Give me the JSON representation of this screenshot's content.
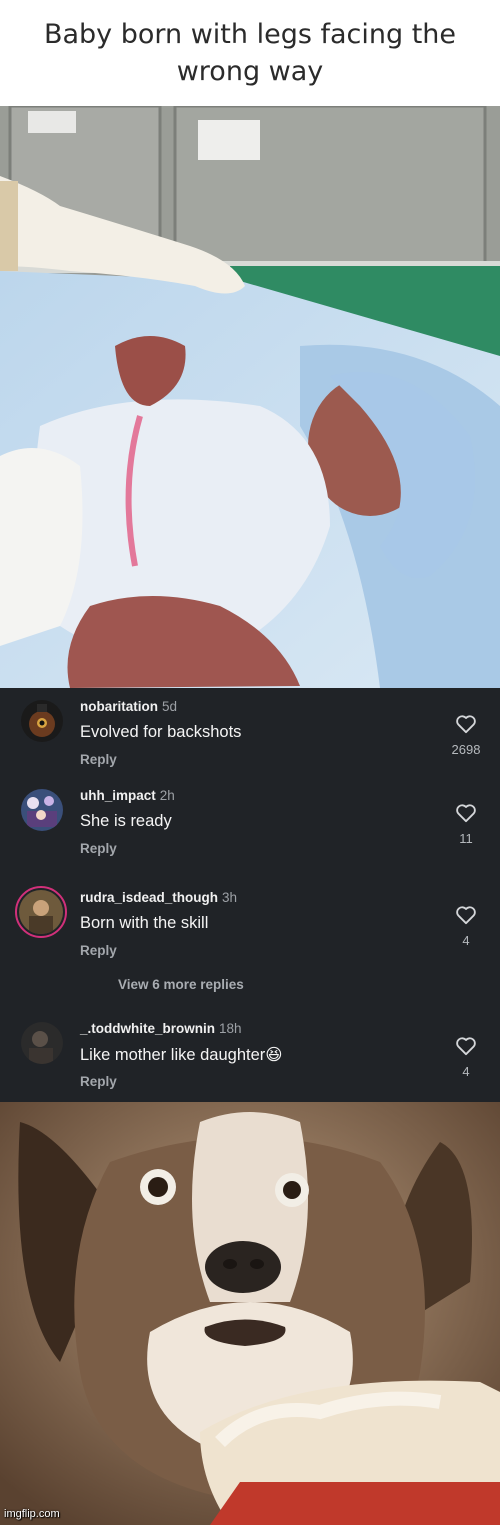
{
  "header": {
    "title_line1": "Baby born with legs facing the",
    "title_line2": "wrong way"
  },
  "colors": {
    "comments_bg": "#202327",
    "text_primary": "#f4f4f4",
    "text_secondary": "#a3a7ac"
  },
  "comments": [
    {
      "username": "nobaritation",
      "time": "5d",
      "text": "Evolved for backshots",
      "reply": "Reply",
      "likes": "2698",
      "icon": "heart-outline-icon"
    },
    {
      "username": "uhh_impact",
      "time": "2h",
      "text": "She is ready",
      "reply": "Reply",
      "likes": "11",
      "icon": "heart-outline-icon"
    },
    {
      "username": "rudra_isdead_though",
      "time": "3h",
      "text": "Born with the skill",
      "reply": "Reply",
      "likes": "4",
      "icon": "heart-outline-icon"
    },
    {
      "username": "_.toddwhite_brownin",
      "time": "18h",
      "text": "Like mother like daughter😆",
      "reply": "Reply",
      "likes": "4",
      "icon": "heart-outline-icon"
    }
  ],
  "view_more": "View 6 more replies",
  "watermark": "imgflip.com"
}
